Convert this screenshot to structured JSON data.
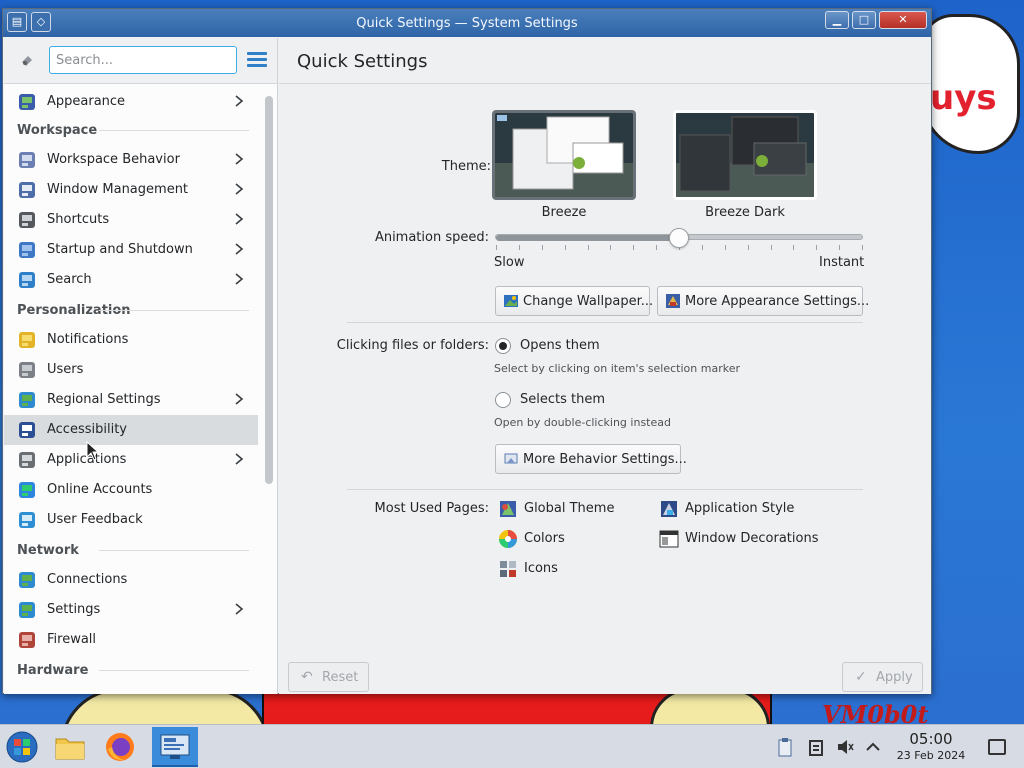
{
  "window": {
    "title": "Quick Settings — System Settings"
  },
  "sidebar": {
    "search_placeholder": "Search...",
    "top_item": {
      "label": "Appearance",
      "icon": "appearance-icon",
      "has_children": true
    },
    "categories": [
      {
        "label": "Workspace",
        "items": [
          {
            "label": "Workspace Behavior",
            "icon": "workspace-behavior-icon",
            "has_children": true
          },
          {
            "label": "Window Management",
            "icon": "window-management-icon",
            "has_children": true
          },
          {
            "label": "Shortcuts",
            "icon": "keyboard-icon",
            "has_children": true
          },
          {
            "label": "Startup and Shutdown",
            "icon": "startup-icon",
            "has_children": true
          },
          {
            "label": "Search",
            "icon": "search-icon",
            "has_children": true
          }
        ]
      },
      {
        "label": "Personalization",
        "items": [
          {
            "label": "Notifications",
            "icon": "bell-icon",
            "has_children": false
          },
          {
            "label": "Users",
            "icon": "users-icon",
            "has_children": false
          },
          {
            "label": "Regional Settings",
            "icon": "globe-icon",
            "has_children": true
          },
          {
            "label": "Accessibility",
            "icon": "accessibility-icon",
            "has_children": false,
            "selected": true
          },
          {
            "label": "Applications",
            "icon": "applications-icon",
            "has_children": true
          },
          {
            "label": "Online Accounts",
            "icon": "online-accounts-icon",
            "has_children": false
          },
          {
            "label": "User Feedback",
            "icon": "feedback-icon",
            "has_children": false
          }
        ]
      },
      {
        "label": "Network",
        "items": [
          {
            "label": "Connections",
            "icon": "network-globe-icon",
            "has_children": false
          },
          {
            "label": "Settings",
            "icon": "network-settings-icon",
            "has_children": true
          },
          {
            "label": "Firewall",
            "icon": "firewall-icon",
            "has_children": false
          }
        ]
      },
      {
        "label": "Hardware",
        "items": []
      }
    ]
  },
  "main": {
    "title": "Quick Settings",
    "theme": {
      "label": "Theme:",
      "options": [
        {
          "name": "Breeze",
          "selected": true
        },
        {
          "name": "Breeze Dark",
          "selected": false
        }
      ]
    },
    "animation": {
      "label": "Animation speed:",
      "min_label": "Slow",
      "max_label": "Instant",
      "value_fraction": 0.5
    },
    "buttons": {
      "change_wallpaper": "Change Wallpaper...",
      "more_appearance": "More Appearance Settings...",
      "more_behavior": "More Behavior Settings..."
    },
    "clicking": {
      "label": "Clicking files or folders:",
      "options": [
        {
          "label": "Opens them",
          "hint": "Select by clicking on item's selection marker",
          "checked": true
        },
        {
          "label": "Selects them",
          "hint": "Open by double-clicking instead",
          "checked": false
        }
      ]
    },
    "most_used": {
      "label": "Most Used Pages:",
      "items": [
        {
          "label": "Global Theme",
          "icon": "global-theme-icon"
        },
        {
          "label": "Application Style",
          "icon": "application-style-icon"
        },
        {
          "label": "Colors",
          "icon": "colors-icon"
        },
        {
          "label": "Window Decorations",
          "icon": "window-decorations-icon"
        },
        {
          "label": "Icons",
          "icon": "icons-icon"
        }
      ]
    },
    "footer": {
      "reset": "Reset",
      "apply": "Apply"
    }
  },
  "desktop": {
    "cloud_text": "uys",
    "watermark": "VM0b0t"
  },
  "taskbar": {
    "clock_time": "05:00",
    "clock_date": "23 Feb 2024"
  }
}
